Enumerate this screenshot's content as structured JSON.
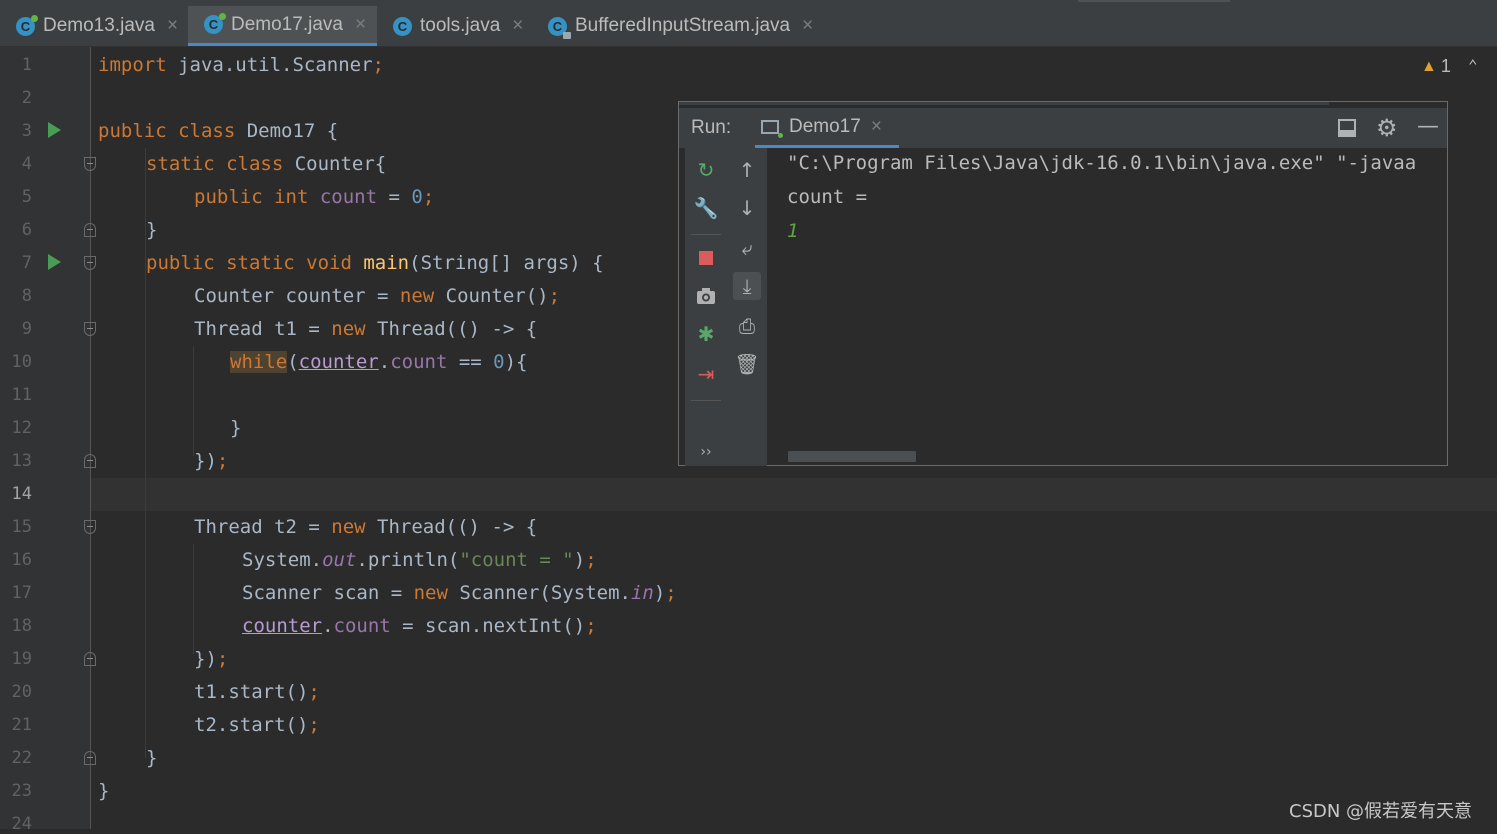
{
  "tabs": [
    {
      "label": "Demo13.java",
      "icon": "java-class-icon",
      "active": false
    },
    {
      "label": "Demo17.java",
      "icon": "java-class-icon",
      "active": true
    },
    {
      "label": "tools.java",
      "icon": "java-class-icon",
      "active": false
    },
    {
      "label": "BufferedInputStream.java",
      "icon": "java-class-readonly-icon",
      "active": false
    }
  ],
  "editor": {
    "line_numbers": [
      "1",
      "2",
      "3",
      "4",
      "5",
      "6",
      "7",
      "8",
      "9",
      "10",
      "11",
      "12",
      "13",
      "14",
      "15",
      "16",
      "17",
      "18",
      "19",
      "20",
      "21",
      "22",
      "23",
      "24"
    ],
    "current_line": "14",
    "warning_count": "1",
    "code": {
      "l1": {
        "a": "import",
        "b": " java.util.Scanner",
        "c": ";"
      },
      "l3": {
        "a": "public class",
        "b": " Demo17 {"
      },
      "l4": {
        "a": "static class",
        "b": " Counter{"
      },
      "l5": {
        "a": "public int",
        "b": " ",
        "c": "count",
        "d": " = ",
        "e": "0",
        "f": ";"
      },
      "l6": {
        "a": "}"
      },
      "l7": {
        "a": "public static void",
        "b": " ",
        "c": "main",
        "d": "(String[] args) {"
      },
      "l8": {
        "a": "Counter counter = ",
        "b": "new",
        "c": " Counter()",
        "d": ";"
      },
      "l9": {
        "a": "Thread t1 = ",
        "b": "new",
        "c": " Thread(() -> {"
      },
      "l10": {
        "a": "while",
        "b": "(",
        "c": "counter",
        "d": ".",
        "e": "count",
        "f": " == ",
        "g": "0",
        "h": "){"
      },
      "l12": {
        "a": "}"
      },
      "l13": {
        "a": "})",
        "b": ";"
      },
      "l15": {
        "a": "Thread t2 = ",
        "b": "new",
        "c": " Thread(() -> {"
      },
      "l16": {
        "a": "System.",
        "b": "out",
        "c": ".println(",
        "d": "\"count = \"",
        "e": ")",
        "f": ";"
      },
      "l17": {
        "a": "Scanner scan = ",
        "b": "new",
        "c": " Scanner(System.",
        "d": "in",
        "e": ")",
        "f": ";"
      },
      "l18": {
        "a": "counter",
        "b": ".",
        "c": "count",
        "d": " = scan.nextInt()",
        "e": ";"
      },
      "l19": {
        "a": "})",
        "b": ";"
      },
      "l20": {
        "a": "t1.start()",
        "b": ";"
      },
      "l21": {
        "a": "t2.start()",
        "b": ";"
      },
      "l22": {
        "a": "}"
      },
      "l23": {
        "a": "}"
      }
    }
  },
  "run_panel": {
    "label": "Run:",
    "tab": "Demo17",
    "output": [
      "\"C:\\Program Files\\Java\\jdk-16.0.1\\bin\\java.exe\" \"-javaa",
      "count = ",
      "1"
    ],
    "more": "››"
  },
  "watermark": "CSDN @假若爱有天意"
}
